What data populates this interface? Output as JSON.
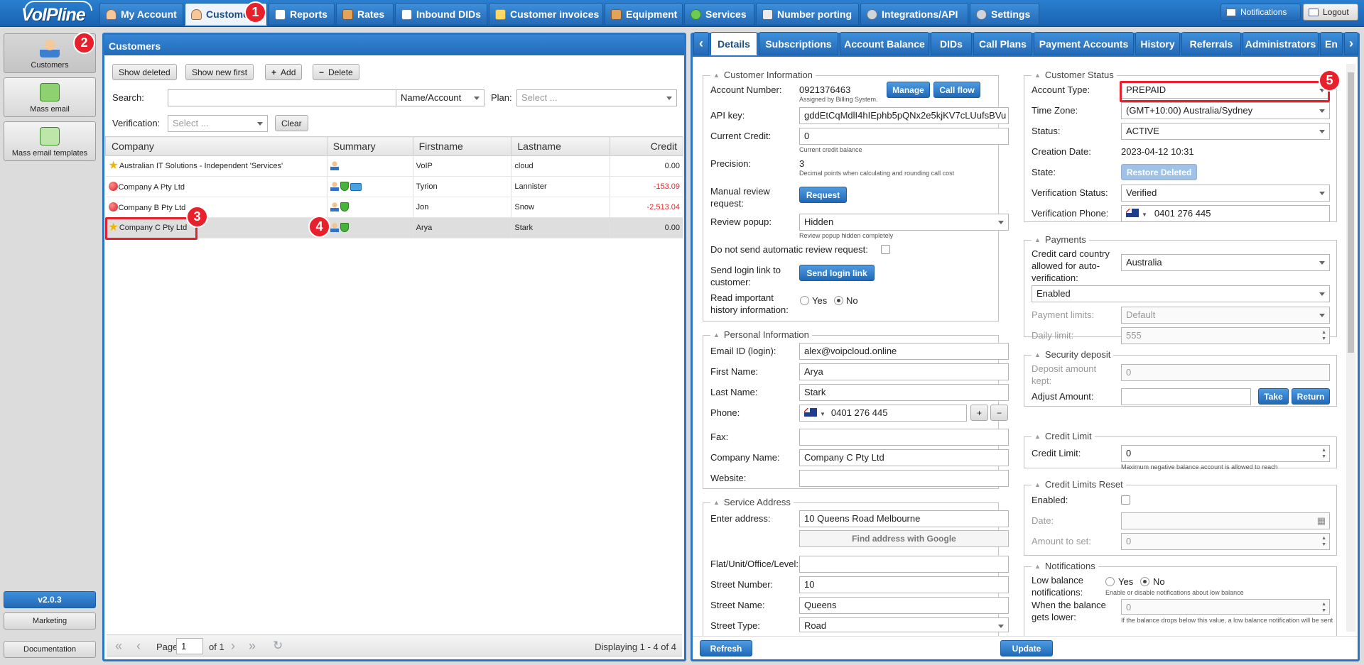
{
  "app": {
    "logo": "VoIPline"
  },
  "nav": {
    "tabs": [
      {
        "label": "My Account",
        "icon": "person-icon"
      },
      {
        "label": "Customers",
        "icon": "person-icon"
      },
      {
        "label": "Reports",
        "icon": "document-icon"
      },
      {
        "label": "Rates",
        "icon": "rates-icon"
      },
      {
        "label": "Inbound DIDs",
        "icon": "document-icon"
      },
      {
        "label": "Customer invoices",
        "icon": "invoice-icon"
      },
      {
        "label": "Equipment",
        "icon": "box-icon"
      },
      {
        "label": "Services",
        "icon": "services-icon"
      },
      {
        "label": "Number porting",
        "icon": "phone-icon"
      },
      {
        "label": "Integrations/API",
        "icon": "gear-icon"
      },
      {
        "label": "Settings",
        "icon": "gear-icon"
      }
    ],
    "notifications": "Notifications",
    "logout": "Logout"
  },
  "sidebar": {
    "customers": "Customers",
    "mass_email": "Mass email",
    "mass_email_templates": "Mass email templates",
    "version": "v2.0.3",
    "marketing": "Marketing",
    "documentation": "Documentation"
  },
  "customers_panel": {
    "title": "Customers",
    "toolbar": {
      "show_deleted": "Show deleted",
      "show_new_first": "Show new first",
      "add": "Add",
      "delete": "Delete"
    },
    "search_label": "Search:",
    "search_value": "",
    "search_mode": "Name/Account",
    "plan_label": "Plan:",
    "plan_placeholder": "Select ...",
    "verification_label": "Verification:",
    "verification_placeholder": "Select ...",
    "clear": "Clear",
    "columns": [
      "Company",
      "Summary",
      "Firstname",
      "Lastname",
      "Credit"
    ],
    "rows": [
      {
        "company": "Australian IT Solutions - Independent 'Services'",
        "marker": "star",
        "first": "VoIP",
        "last": "cloud",
        "credit": "0.00",
        "negative": false
      },
      {
        "company": "Company A Pty Ltd",
        "marker": "red-dot",
        "first": "Tyrion",
        "last": "Lannister",
        "credit": "-153.09",
        "negative": true
      },
      {
        "company": "Company B Pty Ltd",
        "marker": "red-dot",
        "first": "Jon",
        "last": "Snow",
        "credit": "-2,513.04",
        "negative": true
      },
      {
        "company": "Company C Pty Ltd",
        "marker": "star",
        "first": "Arya",
        "last": "Stark",
        "credit": "0.00",
        "negative": false
      }
    ],
    "pager": {
      "page_label": "Page",
      "page": "1",
      "of": "of 1",
      "displaying": "Displaying 1 - 4 of 4"
    }
  },
  "detail_tabs": [
    "Details",
    "Subscriptions",
    "Account Balance",
    "DIDs",
    "Call Plans",
    "Payment Accounts",
    "History",
    "Referrals",
    "Administrators",
    "En"
  ],
  "customer_info": {
    "legend": "Customer Information",
    "account_number_label": "Account Number:",
    "account_number": "0921376463",
    "account_hint": "Assigned by Billing System.",
    "manage": "Manage",
    "call_flow": "Call flow",
    "api_key_label": "API key:",
    "api_key": "gddEtCqMdlI4hIEphb5pQNx2e5kjKV7cLUufsBVu",
    "current_credit_label": "Current Credit:",
    "current_credit": "0",
    "credit_hint": "Current credit balance",
    "precision_label": "Precision:",
    "precision": "3",
    "precision_hint": "Decimal points when calculating and rounding call cost",
    "manual_review_label": "Manual review request:",
    "request": "Request",
    "review_popup_label": "Review popup:",
    "review_popup": "Hidden",
    "review_popup_hint": "Review popup hidden completely",
    "no_auto_review_label": "Do not send automatic review request:",
    "send_login_label": "Send login link to customer:",
    "send_login": "Send login link",
    "read_history_label": "Read important history information:",
    "yes": "Yes",
    "no": "No"
  },
  "personal": {
    "legend": "Personal Information",
    "email_label": "Email ID (login):",
    "email": "alex@voipcloud.online",
    "first_label": "First Name:",
    "first": "Arya",
    "last_label": "Last Name:",
    "last": "Stark",
    "phone_label": "Phone:",
    "phone": "0401 276 445",
    "fax_label": "Fax:",
    "fax": "",
    "company_label": "Company Name:",
    "company": "Company C Pty Ltd",
    "website_label": "Website:",
    "website": ""
  },
  "service_address": {
    "legend": "Service Address",
    "enter_label": "Enter address:",
    "enter": "10 Queens Road Melbourne",
    "find_google": "Find address with Google",
    "flat_label": "Flat/Unit/Office/Level:",
    "flat": "",
    "street_number_label": "Street Number:",
    "street_number": "10",
    "street_name_label": "Street Name:",
    "street_name": "Queens",
    "street_type_label": "Street Type:",
    "street_type": "Road"
  },
  "status": {
    "legend": "Customer Status",
    "account_type_label": "Account Type:",
    "account_type": "PREPAID",
    "timezone_label": "Time Zone:",
    "timezone": "(GMT+10:00) Australia/Sydney",
    "status_label": "Status:",
    "status": "ACTIVE",
    "creation_label": "Creation Date:",
    "creation": "2023-04-12 10:31",
    "state_label": "State:",
    "restore_deleted": "Restore Deleted",
    "verification_status_label": "Verification Status:",
    "verification_status": "Verified",
    "verification_phone_label": "Verification Phone:",
    "verification_phone": "0401 276 445"
  },
  "payments": {
    "legend": "Payments",
    "cc_country_label": "Credit card country allowed for auto-verification:",
    "cc_country": "Australia",
    "enabled": "Enabled",
    "limits_label": "Payment limits:",
    "limits": "Default",
    "daily_label": "Daily limit:",
    "daily": "555"
  },
  "deposit": {
    "legend": "Security deposit",
    "kept_label": "Deposit amount kept:",
    "kept": "0",
    "adjust_label": "Adjust Amount:",
    "take": "Take",
    "return": "Return"
  },
  "credit_limit": {
    "legend": "Credit Limit",
    "label": "Credit Limit:",
    "value": "0",
    "hint": "Maximum negative balance account is allowed to reach"
  },
  "limits_reset": {
    "legend": "Credit Limits Reset",
    "enabled_label": "Enabled:",
    "date_label": "Date:",
    "amount_label": "Amount to set:",
    "amount": "0"
  },
  "notifications": {
    "legend": "Notifications",
    "low_label": "Low balance notifications:",
    "yes": "Yes",
    "no": "No",
    "low_hint": "Enable or disable notifications about low balance",
    "lower_label": "When the balance gets lower:",
    "lower": "0",
    "lower_hint": "If the balance drops below this value, a low balance notification will be sent"
  },
  "actions": {
    "refresh": "Refresh",
    "update": "Update"
  },
  "annotations": [
    "1",
    "2",
    "3",
    "4",
    "5"
  ]
}
